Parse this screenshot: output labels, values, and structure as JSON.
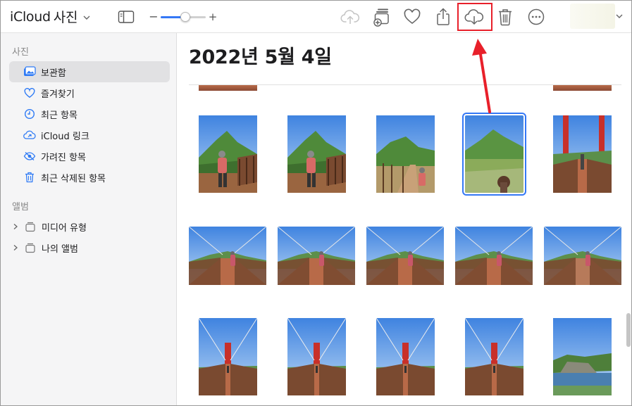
{
  "app": {
    "brand": "iCloud",
    "section_title": "사진"
  },
  "toolbar": {
    "zoom_minus": "−",
    "zoom_plus": "+",
    "zoom_level": 0.55,
    "actions": [
      {
        "name": "upload",
        "icon": "cloud-upload-icon",
        "disabled": true
      },
      {
        "name": "add-to-album",
        "icon": "add-to-album-icon"
      },
      {
        "name": "favorite",
        "icon": "heart-icon"
      },
      {
        "name": "share",
        "icon": "share-icon"
      },
      {
        "name": "download",
        "icon": "cloud-download-icon",
        "highlighted": true
      },
      {
        "name": "delete",
        "icon": "trash-icon"
      },
      {
        "name": "more",
        "icon": "ellipsis-circle-icon"
      }
    ]
  },
  "sidebar": {
    "photos_header": "사진",
    "items": [
      {
        "label": "보관함",
        "icon": "library-icon",
        "selected": true
      },
      {
        "label": "즐겨찾기",
        "icon": "heart-icon"
      },
      {
        "label": "최근 항목",
        "icon": "clock-icon"
      },
      {
        "label": "iCloud 링크",
        "icon": "cloud-link-icon"
      },
      {
        "label": "가려진 항목",
        "icon": "eye-slash-icon"
      },
      {
        "label": "최근 삭제된 항목",
        "icon": "trash-icon"
      }
    ],
    "albums_header": "앨범",
    "albums": [
      {
        "label": "미디어 유형",
        "icon": "album-stack-icon"
      },
      {
        "label": "나의 앨범",
        "icon": "album-stack-icon"
      }
    ]
  },
  "main": {
    "date_title": "2022년 5월 4일",
    "photos": [
      {
        "kind": "mountain-person",
        "row": 1
      },
      {
        "kind": "mountain-person",
        "row": 1
      },
      {
        "kind": "mountain-trail",
        "row": 1
      },
      {
        "kind": "mountain-field",
        "row": 1,
        "selected": true
      },
      {
        "kind": "red-bridge",
        "row": 1
      },
      {
        "kind": "bridge-wide",
        "row": 2
      },
      {
        "kind": "bridge-wide",
        "row": 2
      },
      {
        "kind": "bridge-wide",
        "row": 2
      },
      {
        "kind": "bridge-wide",
        "row": 2
      },
      {
        "kind": "bridge-wide-grey",
        "row": 2
      },
      {
        "kind": "bridge-tall",
        "row": 3
      },
      {
        "kind": "bridge-tall",
        "row": 3
      },
      {
        "kind": "bridge-tall",
        "row": 3
      },
      {
        "kind": "bridge-tall",
        "row": 3
      },
      {
        "kind": "river-cliff",
        "row": 3
      }
    ]
  },
  "colors": {
    "accent": "#3478f6",
    "highlight_red": "#e8202a",
    "sidebar_bg": "#f5f5f6",
    "sidebar_selected": "#e1e1e3"
  }
}
